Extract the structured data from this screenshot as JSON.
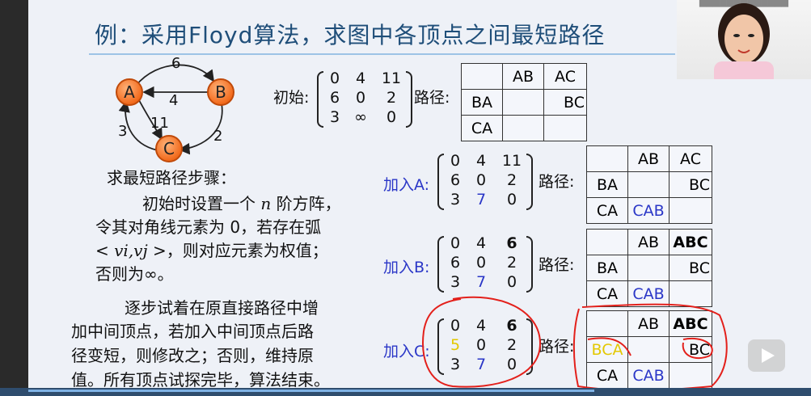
{
  "title": "例：采用Floyd算法，求图中各顶点之间最短路径",
  "graph": {
    "vertices": [
      "A",
      "B",
      "C"
    ],
    "edges": [
      {
        "label": "6"
      },
      {
        "label": "4"
      },
      {
        "label": "11"
      },
      {
        "label": "3"
      },
      {
        "label": "2"
      }
    ]
  },
  "steps_heading": "求最短路径步骤：",
  "paragraph1": {
    "line1_a": "初始时设置一个 ",
    "line1_n": "n",
    "line1_b": " 阶方阵，",
    "line2": "令其对角线元素为 0，若存在弧",
    "line3_a": "< ",
    "line3_v": "vi,vj",
    "line3_b": " >，则对应元素为权值；",
    "line4": "否则为∞。"
  },
  "paragraph2": {
    "line1": "逐步试着在原直接路径中增",
    "line2": "加中间顶点，若加入中间顶点后路",
    "line3": "径变短，则修改之；否则，维持原",
    "line4": "值。所有顶点试探完毕，算法结束。"
  },
  "path_label": "路径:",
  "matrices": [
    {
      "label": "初始:",
      "rows": [
        [
          "0",
          "4",
          "11"
        ],
        [
          "6",
          "0",
          "2"
        ],
        [
          "3",
          "∞",
          "0"
        ]
      ],
      "table": [
        [
          "",
          "AB",
          "AC"
        ],
        [
          "BA",
          "",
          "BC"
        ],
        [
          "CA",
          "",
          ""
        ]
      ]
    },
    {
      "label": "加入A:",
      "rows": [
        [
          "0",
          "4",
          "11"
        ],
        [
          "6",
          "0",
          "2"
        ],
        [
          "3",
          "7",
          "0"
        ]
      ],
      "table": [
        [
          "",
          "AB",
          "AC"
        ],
        [
          "BA",
          "",
          "BC"
        ],
        [
          "CA",
          "CAB",
          ""
        ]
      ]
    },
    {
      "label": "加入B:",
      "rows": [
        [
          "0",
          "4",
          "6"
        ],
        [
          "6",
          "0",
          "2"
        ],
        [
          "3",
          "7",
          "0"
        ]
      ],
      "table": [
        [
          "",
          "AB",
          "ABC"
        ],
        [
          "BA",
          "",
          "BC"
        ],
        [
          "CA",
          "CAB",
          ""
        ]
      ]
    },
    {
      "label": "加入C:",
      "rows": [
        [
          "0",
          "4",
          "6"
        ],
        [
          "5",
          "0",
          "2"
        ],
        [
          "3",
          "7",
          "0"
        ]
      ],
      "table": [
        [
          "",
          "AB",
          "ABC"
        ],
        [
          "BCA",
          "",
          "BC"
        ],
        [
          "CA",
          "CAB",
          ""
        ]
      ]
    }
  ],
  "colors": {
    "title": "#1f4e79",
    "updated_value": "#2a36c7",
    "new_value": "#e3c800",
    "annotation": "#e3201b",
    "vertex": "#f26b1d"
  }
}
